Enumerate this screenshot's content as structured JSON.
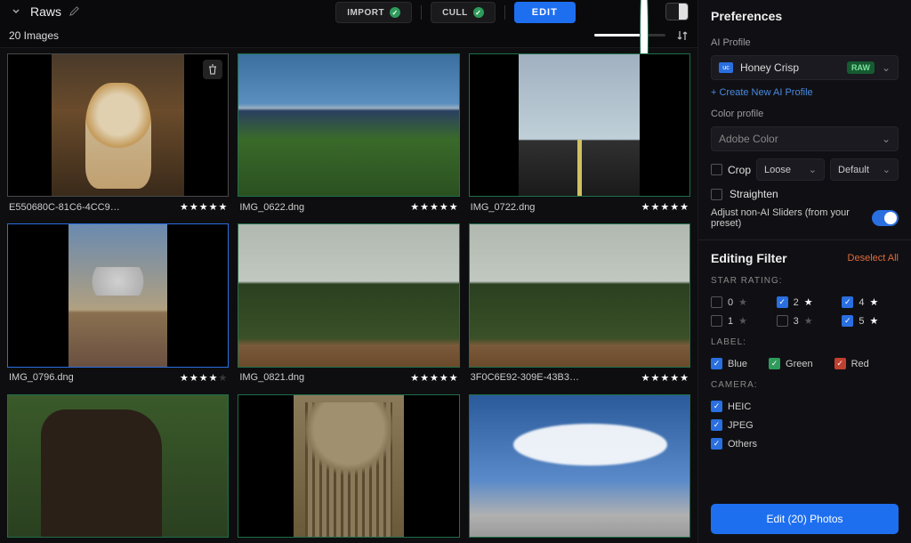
{
  "header": {
    "breadcrumb": "Raws",
    "import_label": "IMPORT",
    "cull_label": "CULL",
    "edit_label": "EDIT"
  },
  "subheader": {
    "count_label": "20 Images"
  },
  "images": [
    {
      "filename": "E550680C-81C6-4CC9…",
      "rating": 5,
      "selected": "grey",
      "trash": true,
      "ph": "dog"
    },
    {
      "filename": "IMG_0622.dng",
      "rating": 5,
      "selected": "green",
      "ph": "coast"
    },
    {
      "filename": "IMG_0722.dng",
      "rating": 5,
      "selected": "green",
      "ph": "road"
    },
    {
      "filename": "IMG_0796.dng",
      "rating": 4,
      "selected": "blue",
      "ph": "beach"
    },
    {
      "filename": "IMG_0821.dng",
      "rating": 5,
      "selected": "green",
      "ph": "forest"
    },
    {
      "filename": "3F0C6E92-309E-43B3…",
      "rating": 5,
      "selected": "green",
      "ph": "forest"
    },
    {
      "filename": "",
      "rating": 0,
      "selected": "green",
      "ph": "tree"
    },
    {
      "filename": "",
      "rating": 0,
      "selected": "green",
      "ph": "cat"
    },
    {
      "filename": "",
      "rating": 0,
      "selected": "green",
      "ph": "sky"
    }
  ],
  "prefs": {
    "title": "Preferences",
    "ai_profile_label": "AI Profile",
    "ai_profile_value": "Honey Crisp",
    "ai_profile_tag": "RAW",
    "create_profile_link": "+ Create New AI Profile",
    "color_profile_label": "Color profile",
    "color_profile_value": "Adobe Color",
    "crop_label": "Crop",
    "crop_mode": "Loose",
    "crop_preset": "Default",
    "straighten_label": "Straighten",
    "adjust_label": "Adjust non-AI Sliders (from your preset)"
  },
  "filter": {
    "title": "Editing Filter",
    "deselect_label": "Deselect All",
    "star_rating_label": "STAR RATING:",
    "stars": [
      {
        "n": "0",
        "on": false
      },
      {
        "n": "2",
        "on": true
      },
      {
        "n": "4",
        "on": true
      },
      {
        "n": "1",
        "on": false
      },
      {
        "n": "3",
        "on": false
      },
      {
        "n": "5",
        "on": true
      }
    ],
    "label_label": "LABEL:",
    "labels": [
      {
        "name": "Blue",
        "color": "blue"
      },
      {
        "name": "Green",
        "color": "green"
      },
      {
        "name": "Red",
        "color": "red"
      }
    ],
    "camera_label": "CAMERA:",
    "cameras": [
      {
        "name": "HEIC"
      },
      {
        "name": "JPEG"
      },
      {
        "name": "Others"
      }
    ],
    "edit_button": "Edit (20) Photos"
  }
}
